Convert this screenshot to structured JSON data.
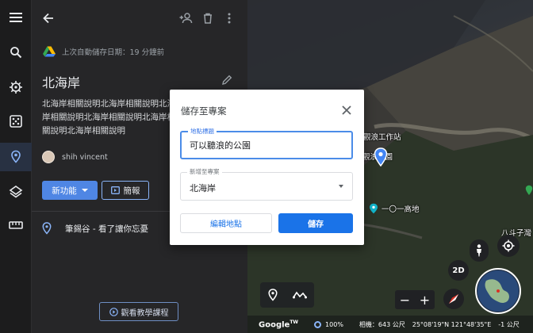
{
  "rail": {
    "items": [
      {
        "icon": "menu-icon"
      },
      {
        "icon": "search-icon"
      },
      {
        "icon": "voyager-wheel-icon"
      },
      {
        "icon": "dice-icon"
      },
      {
        "icon": "projects-pin-icon"
      },
      {
        "icon": "layers-icon"
      },
      {
        "icon": "ruler-icon"
      }
    ]
  },
  "panel": {
    "autosave_text": "上次自動儲存日期：19 分鐘前",
    "title": "北海岸",
    "description": "北海岸相關說明北海岸相關說明北海岸相關說明北海岸相關說明北海岸相關說明北海岸相關說明",
    "owner": "shih vincent",
    "new_feature_label": "新功能",
    "brief_label": "簡報",
    "feature_item": "筆錫谷 - 看了讓你忘憂",
    "tutorial_label": "觀看教學課程"
  },
  "map": {
    "poi_station": "觀浪工作站",
    "poi_park": "觀浪公園",
    "poi_highland": "一〇一高地",
    "poi_peak": "八斗子灣",
    "btn_2d": "2D",
    "zoom_out": "−",
    "zoom_in": "+",
    "status": {
      "logo": "Google",
      "logo_tm": "TW",
      "progress": "100%",
      "camera": "相機：643 公尺",
      "coords": "25°08'19\"N 121°48'35\"E",
      "elevation": "-1 公尺"
    }
  },
  "dialog": {
    "title": "儲存至專案",
    "place_label": "地點標題",
    "place_value": "可以聽浪的公園",
    "project_label": "新增至專案",
    "project_value": "北海岸",
    "edit_label": "編輯地點",
    "save_label": "儲存"
  },
  "colors": {
    "accent": "#1a73e8",
    "panel_bg": "#262628",
    "rail_bg": "#1c1c1d",
    "button_blue": "#4f86e4"
  }
}
